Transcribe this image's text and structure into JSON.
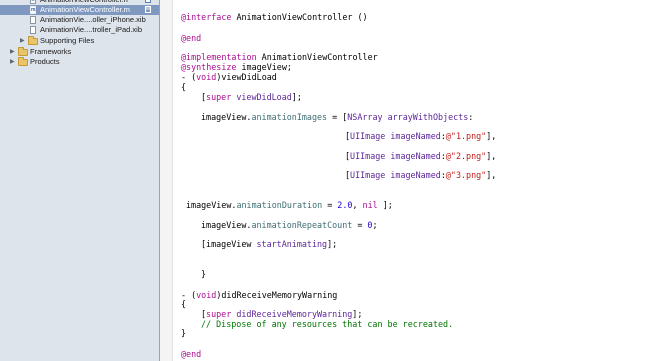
{
  "sidebar": {
    "rows": [
      {
        "label": "AnimationViewController.h",
        "type": "file",
        "icon_letter": "h",
        "badge": "A",
        "selected": false
      },
      {
        "label": "AnimationViewController.m",
        "type": "file",
        "icon_letter": "m",
        "badge": "M",
        "selected": true
      },
      {
        "label": "AnimationVie....oller_iPhone.xib",
        "type": "file",
        "icon_letter": "",
        "badge": "",
        "selected": false
      },
      {
        "label": "AnimationVie....troller_iPad.xib",
        "type": "file",
        "icon_letter": "",
        "badge": "",
        "selected": false
      },
      {
        "label": "Supporting Files",
        "type": "folder",
        "selected": false
      },
      {
        "label": "Frameworks",
        "type": "folder",
        "selected": false
      },
      {
        "label": "Products",
        "type": "folder",
        "selected": false
      }
    ]
  },
  "editor": {
    "colors": {
      "keyword": "#aa0d91",
      "class": "#5c2699",
      "property": "#3f6e74",
      "number": "#1c00cf",
      "string": "#c41a16",
      "comment": "#007400"
    },
    "lines": [
      {
        "tokens": [
          {
            "t": "@interface",
            "c": "kw"
          },
          {
            "t": " AnimationViewController ()",
            "c": "plain"
          }
        ]
      },
      {
        "tokens": [
          {
            "t": "@end",
            "c": "kw"
          }
        ]
      },
      {
        "tokens": [
          {
            "t": "@implementation",
            "c": "kw"
          },
          {
            "t": " AnimationViewController",
            "c": "plain"
          }
        ]
      },
      {
        "tokens": [
          {
            "t": "@synthesize",
            "c": "kw"
          },
          {
            "t": " imageView;",
            "c": "plain"
          }
        ]
      },
      {
        "tokens": [
          {
            "t": "- (",
            "c": "plain"
          },
          {
            "t": "void",
            "c": "kw"
          },
          {
            "t": ")viewDidLoad",
            "c": "plain"
          }
        ]
      },
      {
        "tokens": [
          {
            "t": "{",
            "c": "plain"
          }
        ]
      },
      {
        "tokens": [
          {
            "t": "[",
            "c": "plain"
          },
          {
            "t": "super",
            "c": "kw"
          },
          {
            "t": " ",
            "c": "plain"
          },
          {
            "t": "viewDidLoad",
            "c": "cls"
          },
          {
            "t": "];",
            "c": "plain"
          }
        ]
      },
      {
        "tokens": [
          {
            "t": "imageView",
            "c": "plain"
          },
          {
            "t": ".",
            "c": "plain"
          },
          {
            "t": "animationImages",
            "c": "prop"
          },
          {
            "t": " = [",
            "c": "plain"
          },
          {
            "t": "NSArray",
            "c": "cls"
          },
          {
            "t": " ",
            "c": "plain"
          },
          {
            "t": "arrayWithObjects",
            "c": "cls"
          },
          {
            "t": ":",
            "c": "plain"
          }
        ]
      },
      {
        "tokens": [
          {
            "t": "[",
            "c": "plain"
          },
          {
            "t": "UIImage",
            "c": "cls"
          },
          {
            "t": " ",
            "c": "plain"
          },
          {
            "t": "imageNamed",
            "c": "cls"
          },
          {
            "t": ":",
            "c": "plain"
          },
          {
            "t": "@\"1.png\"",
            "c": "str"
          },
          {
            "t": "],",
            "c": "plain"
          }
        ]
      },
      {
        "tokens": [
          {
            "t": "[",
            "c": "plain"
          },
          {
            "t": "UIImage",
            "c": "cls"
          },
          {
            "t": " ",
            "c": "plain"
          },
          {
            "t": "imageNamed",
            "c": "cls"
          },
          {
            "t": ":",
            "c": "plain"
          },
          {
            "t": "@\"2.png\"",
            "c": "str"
          },
          {
            "t": "],",
            "c": "plain"
          }
        ]
      },
      {
        "tokens": [
          {
            "t": "[",
            "c": "plain"
          },
          {
            "t": "UIImage",
            "c": "cls"
          },
          {
            "t": " ",
            "c": "plain"
          },
          {
            "t": "imageNamed",
            "c": "cls"
          },
          {
            "t": ":",
            "c": "plain"
          },
          {
            "t": "@\"3.png\"",
            "c": "str"
          },
          {
            "t": "],",
            "c": "plain"
          }
        ]
      },
      {
        "tokens": [
          {
            "t": "imageView",
            "c": "plain"
          },
          {
            "t": ".",
            "c": "plain"
          },
          {
            "t": "animationDuration",
            "c": "prop"
          },
          {
            "t": " = ",
            "c": "plain"
          },
          {
            "t": "2.0",
            "c": "num"
          },
          {
            "t": ", ",
            "c": "plain"
          },
          {
            "t": "nil",
            "c": "kw"
          },
          {
            "t": " ];",
            "c": "plain"
          }
        ]
      },
      {
        "tokens": [
          {
            "t": "imageView",
            "c": "plain"
          },
          {
            "t": ".",
            "c": "plain"
          },
          {
            "t": "animationRepeatCount",
            "c": "prop"
          },
          {
            "t": " = ",
            "c": "plain"
          },
          {
            "t": "0",
            "c": "num"
          },
          {
            "t": ";",
            "c": "plain"
          }
        ]
      },
      {
        "tokens": [
          {
            "t": "[",
            "c": "plain"
          },
          {
            "t": "imageView",
            "c": "plain"
          },
          {
            "t": " ",
            "c": "plain"
          },
          {
            "t": "startAnimating",
            "c": "cls"
          },
          {
            "t": "];",
            "c": "plain"
          }
        ]
      },
      {
        "tokens": [
          {
            "t": "}",
            "c": "plain"
          }
        ]
      },
      {
        "tokens": [
          {
            "t": "- (",
            "c": "plain"
          },
          {
            "t": "void",
            "c": "kw"
          },
          {
            "t": ")didReceiveMemoryWarning",
            "c": "plain"
          }
        ]
      },
      {
        "tokens": [
          {
            "t": "{",
            "c": "plain"
          }
        ]
      },
      {
        "tokens": [
          {
            "t": "[",
            "c": "plain"
          },
          {
            "t": "super",
            "c": "kw"
          },
          {
            "t": " ",
            "c": "plain"
          },
          {
            "t": "didReceiveMemoryWarning",
            "c": "cls"
          },
          {
            "t": "];",
            "c": "plain"
          }
        ]
      },
      {
        "tokens": [
          {
            "t": "// Dispose of any resources that can be recreated.",
            "c": "cmt"
          }
        ]
      },
      {
        "tokens": [
          {
            "t": "}",
            "c": "plain"
          }
        ]
      },
      {
        "tokens": [
          {
            "t": "@end",
            "c": "kw"
          }
        ]
      }
    ]
  }
}
